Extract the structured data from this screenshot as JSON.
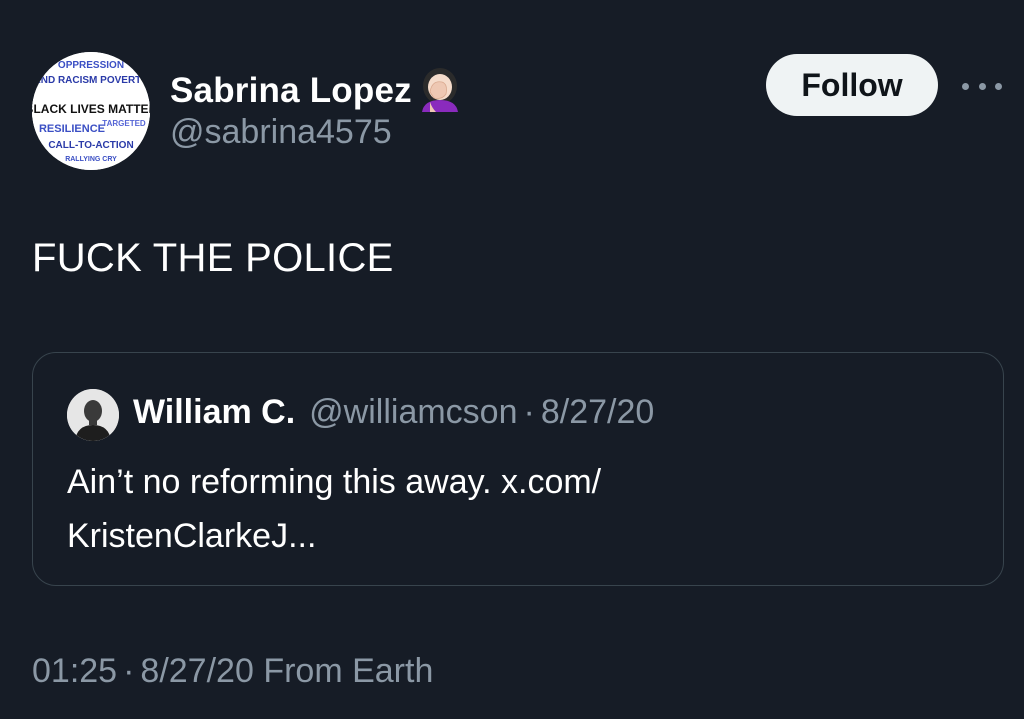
{
  "author": {
    "display_name": "Sabrina Lopez",
    "handle": "@sabrina4575",
    "name_emoji": "🤦🏻‍♀️",
    "avatar_words": [
      "OPPRESSION",
      "END RACISM POVERTY",
      "BLACK LIVES MATTER",
      "RESILIENCE",
      "TARGETED",
      "CALL-TO-ACTION",
      "RALLYING CRY"
    ]
  },
  "actions": {
    "follow_label": "Follow",
    "more_icon": "more-horizontal-icon"
  },
  "tweet": {
    "text": "FUCK THE POLICE"
  },
  "quoted": {
    "display_name": "William C.",
    "handle": "@williamcson",
    "separator": "·",
    "date": "8/27/20",
    "text_line1": "Ain’t no reforming this away. x.com/",
    "text_line2": "KristenClarkeJ..."
  },
  "meta": {
    "time": "01:25",
    "separator": "·",
    "date": "8/27/20",
    "source": "From Earth"
  },
  "colors": {
    "background": "#161c26",
    "text_primary": "#ffffff",
    "text_secondary": "#8b98a5",
    "follow_bg": "#eff3f4",
    "card_border": "#38444d"
  }
}
